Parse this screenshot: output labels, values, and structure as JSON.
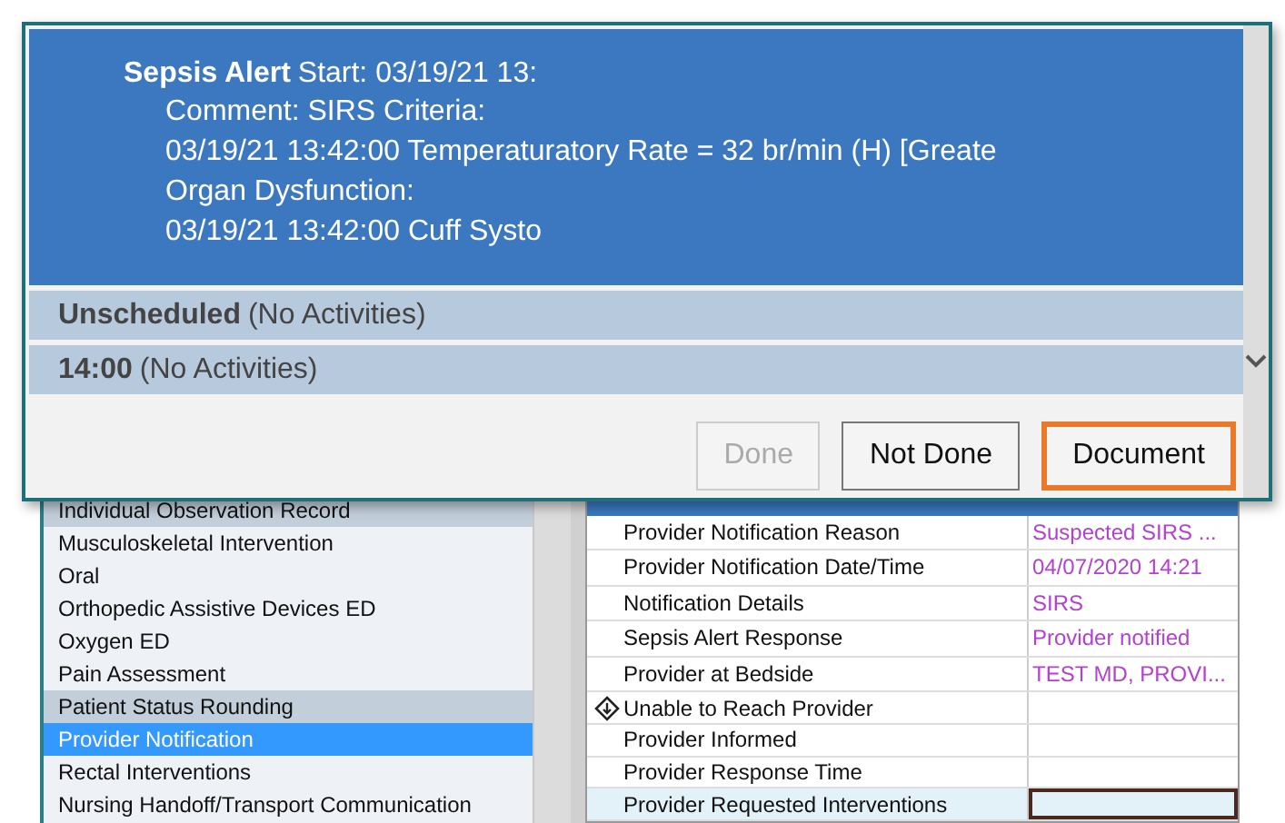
{
  "alert": {
    "title": "Sepsis Alert",
    "start": "Start: 03/19/21 13:",
    "lines": [
      "Comment: SIRS Criteria:",
      "03/19/21 13:42:00 Temperaturatory Rate = 32 br/min (H) [Greate",
      "Organ Dysfunction:",
      "03/19/21 13:42:00 Cuff Systo"
    ]
  },
  "sections": [
    {
      "time": "Unscheduled",
      "note": "(No Activities)"
    },
    {
      "time": "14:00",
      "note": "(No Activities)"
    }
  ],
  "buttons": [
    {
      "label": "Done",
      "disabled": true,
      "focused": false
    },
    {
      "label": "Not Done",
      "disabled": false,
      "focused": false
    },
    {
      "label": "Document",
      "disabled": false,
      "focused": true
    }
  ],
  "list": [
    {
      "label": "Individual Observation Record",
      "shaded": true,
      "selected": false
    },
    {
      "label": "Musculoskeletal Intervention",
      "shaded": false,
      "selected": false
    },
    {
      "label": "Oral",
      "shaded": false,
      "selected": false
    },
    {
      "label": "Orthopedic Assistive Devices ED",
      "shaded": false,
      "selected": false
    },
    {
      "label": "Oxygen ED",
      "shaded": false,
      "selected": false
    },
    {
      "label": "Pain Assessment",
      "shaded": false,
      "selected": false
    },
    {
      "label": "Patient Status Rounding",
      "shaded": true,
      "selected": false
    },
    {
      "label": "Provider Notification",
      "shaded": false,
      "selected": true
    },
    {
      "label": "Rectal Interventions",
      "shaded": false,
      "selected": false
    },
    {
      "label": "Nursing Handoff/Transport Communication",
      "shaded": false,
      "selected": false
    }
  ],
  "grid": [
    {
      "label": "Provider Notification Reason",
      "value": "Suspected SIRS ...",
      "flagged": false,
      "selected": false
    },
    {
      "label": "Provider Notification Date/Time",
      "value": "04/07/2020 14:21",
      "flagged": false,
      "selected": false
    },
    {
      "label": "Notification Details",
      "value": "SIRS",
      "flagged": false,
      "selected": false
    },
    {
      "label": "Sepsis Alert Response",
      "value": "Provider notified",
      "flagged": false,
      "selected": false
    },
    {
      "label": "Provider at Bedside",
      "value": "TEST MD, PROVI...",
      "flagged": false,
      "selected": false
    },
    {
      "label": "Unable to Reach Provider",
      "flagged": true,
      "selected": false
    },
    {
      "label": "Provider Informed",
      "flagged": false,
      "selected": false
    },
    {
      "label": "Provider Response Time",
      "flagged": false,
      "selected": false
    },
    {
      "label": "Provider Requested Interventions",
      "flagged": false,
      "selected": true
    }
  ]
}
